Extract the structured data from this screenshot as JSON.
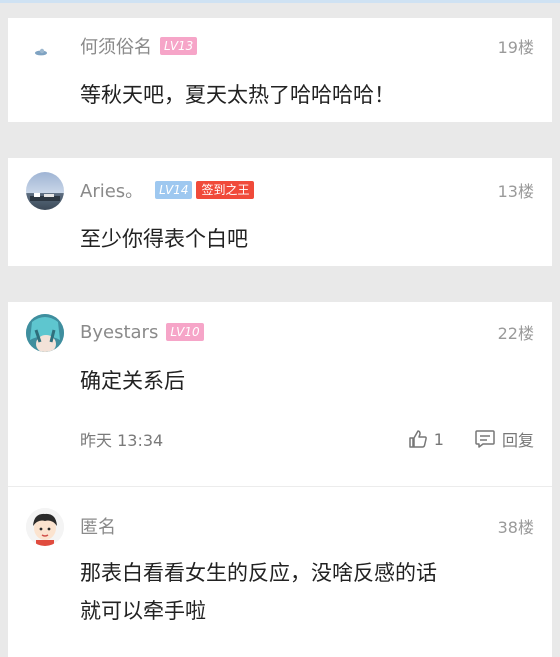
{
  "comments": [
    {
      "username": "何须俗名",
      "level": "LV13",
      "level_color": "#f6a5c8",
      "floor": "19楼",
      "content": "等秋天吧，夏天太热了哈哈哈哈！"
    },
    {
      "username": "Aries。",
      "level": "LV14",
      "level_color": "#9ec8f0",
      "title_badge": "签到之王",
      "floor": "13楼",
      "content": "至少你得表个白吧"
    },
    {
      "username": "Byestars",
      "level": "LV10",
      "level_color": "#f6a5c8",
      "floor": "22楼",
      "content": "确定关系后",
      "time": "昨天 13:34",
      "like_count": "1",
      "reply_label": "回复"
    },
    {
      "username": "匿名",
      "floor": "38楼",
      "content_line1": "那表白看看女生的反应，没啥反感的话",
      "content_line2": "就可以牵手啦"
    }
  ]
}
